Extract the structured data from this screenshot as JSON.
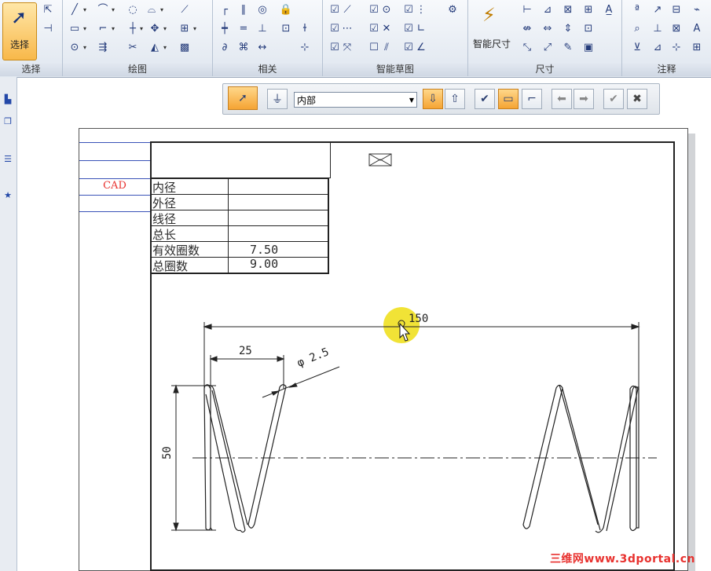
{
  "ribbon": {
    "select_label": "选择",
    "groups": [
      "选择",
      "绘图",
      "相关",
      "智能草图",
      "尺寸",
      "注释"
    ],
    "smart_dimension_label": "智能尺寸"
  },
  "quickbar": {
    "filter_value": "内部"
  },
  "sheet": {
    "cad_label": "CAD",
    "table_rows": [
      {
        "label": "内径",
        "value": ""
      },
      {
        "label": "外径",
        "value": ""
      },
      {
        "label": "线径",
        "value": ""
      },
      {
        "label": "总长",
        "value": ""
      },
      {
        "label": "有效圈数",
        "value": "7.50"
      },
      {
        "label": "总圈数",
        "value": "9.00"
      }
    ],
    "dims": {
      "overall_length": "150",
      "pitch": "25",
      "wire_diameter": "φ 2.5",
      "height": "50"
    }
  },
  "watermark": "三维网www.3dportal.cn",
  "colors": {
    "accent": "#f8b84a",
    "cursor_highlight": "#f0e020",
    "title_rule": "#3a52b8",
    "cad_text": "#e8322f"
  }
}
